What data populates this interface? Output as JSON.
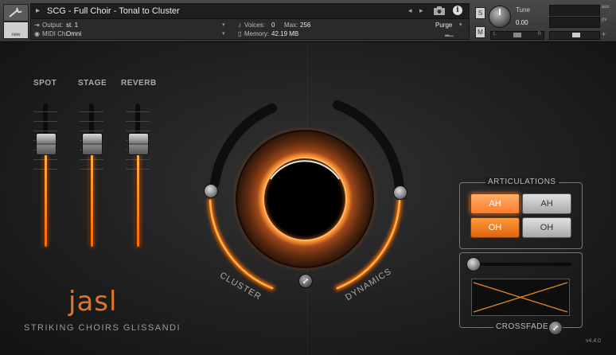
{
  "header": {
    "instrument_title": "SCG - Full Choir - Tonal to Cluster",
    "output_label": "Output:",
    "output_value": "st. 1",
    "midi_label": "MIDI Ch:",
    "midi_value": "Omni",
    "voices_label": "Voices:",
    "voices_value": "0",
    "max_label": "Max:",
    "max_value": "256",
    "memory_label": "Memory:",
    "memory_value": "42.19 MB",
    "purge_label": "Purge",
    "new_label": "new",
    "s_button": "S",
    "m_button": "M",
    "tune_label": "Tune",
    "tune_value": "0.00",
    "aux_label": "aux",
    "pv_label": "pv",
    "pan_left": "L",
    "pan_right": "R"
  },
  "mixer": {
    "faders": [
      {
        "label": "SPOT",
        "level": 0.72
      },
      {
        "label": "STAGE",
        "level": 0.72
      },
      {
        "label": "REVERB",
        "level": 0.72
      }
    ]
  },
  "main": {
    "cluster_label": "CLUSTER",
    "dynamics_label": "DYNAMICS",
    "cluster_level": 0.5,
    "dynamics_level": 0.5
  },
  "articulations": {
    "title": "ARTICULATIONS",
    "buttons": [
      {
        "label": "AH",
        "state": "on"
      },
      {
        "label": "AH",
        "state": "off"
      },
      {
        "label": "OH",
        "state": "on"
      },
      {
        "label": "OH",
        "state": "off"
      }
    ]
  },
  "crossfade": {
    "title": "CROSSFADE",
    "level": 0.0
  },
  "brand": {
    "logo": "jasl",
    "product": "STRIKING CHOIRS GLISSANDI",
    "version": "v4.4.0"
  },
  "colors": {
    "accent": "#ff7a2a",
    "glow": "#ffb347"
  }
}
